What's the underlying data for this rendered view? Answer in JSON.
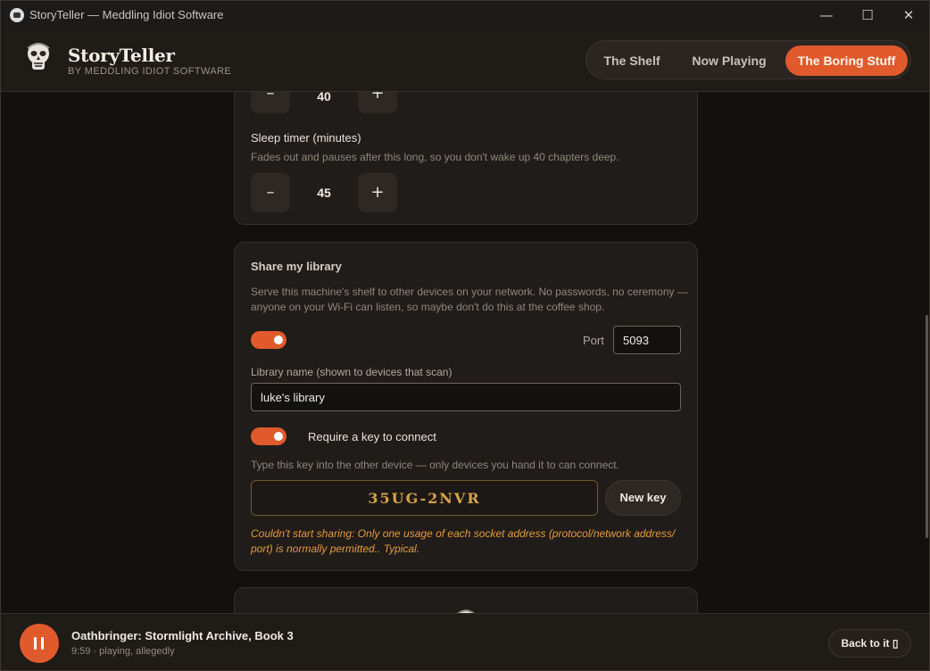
{
  "window": {
    "title": "StoryTeller — Meddling Idiot Software",
    "minimize_glyph": "—",
    "maximize_glyph": "☐",
    "close_glyph": "✕"
  },
  "header": {
    "brand_title": "StoryTeller",
    "brand_subtitle": "BY MEDDLING IDIOT SOFTWARE",
    "tabs": [
      {
        "label": "The Shelf",
        "active": false
      },
      {
        "label": "Now Playing",
        "active": false
      },
      {
        "label": "The Boring Stuff",
        "active": true
      }
    ]
  },
  "settings": {
    "upper_stepper": {
      "minus": "–",
      "value": "40",
      "plus": "+"
    },
    "sleep_timer": {
      "label": "Sleep timer (minutes)",
      "help": "Fades out and pauses after this long, so you don't wake up 40 chapters deep.",
      "minus": "–",
      "value": "45",
      "plus": "+"
    },
    "share": {
      "title": "Share my library",
      "description_line1": "Serve this machine's shelf to other devices on your network. No passwords, no ceremony —",
      "description_line2": "anyone on your Wi-Fi can listen, so maybe don't do this at the coffee shop.",
      "enabled": true,
      "port_label": "Port",
      "port_value": "5093",
      "library_name_label": "Library name (shown to devices that scan)",
      "library_name_value": "luke's library",
      "require_key": true,
      "require_key_label": "Require a key to connect",
      "key_help": "Type this key into the other device — only devices you hand it to can connect.",
      "key_value": "35UG-2NVR",
      "new_key_label": "New key",
      "error_line1": "Couldn't start sharing: Only one usage of each socket address (protocol/network address/",
      "error_line2": "port) is normally permitted.. Typical."
    }
  },
  "player": {
    "book_title": "Oathbringer: Stormlight Archive, Book 3",
    "status": "9:59 · playing, allegedly",
    "back_label": "Back to it ▯"
  },
  "colors": {
    "accent": "#e05a2b",
    "key_text": "#d9a244",
    "error_text": "#e59a3c"
  }
}
